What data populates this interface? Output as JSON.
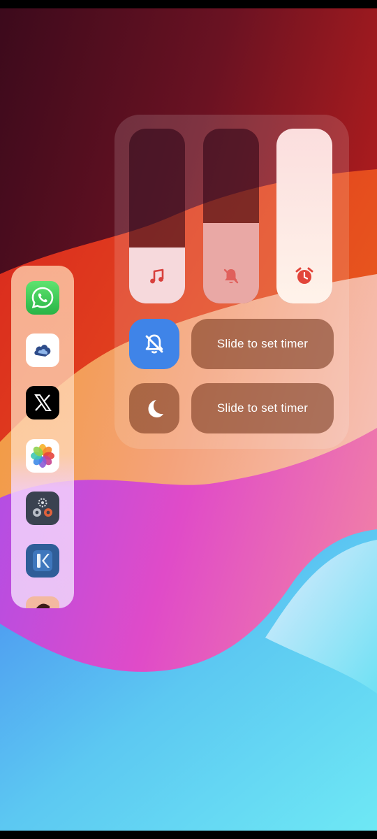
{
  "volume_panel": {
    "sliders": [
      {
        "id": "media",
        "icon": "music-note-icon",
        "level": 0.32
      },
      {
        "id": "ring",
        "icon": "bell-off-icon",
        "level": 0.46
      },
      {
        "id": "alarm",
        "icon": "alarm-clock-icon",
        "level": 1.0
      }
    ],
    "sound_mode_icon": "bell-off-icon",
    "dnd_icon": "moon-icon",
    "timer_1_label": "Slide to set timer",
    "timer_2_label": "Slide to set timer"
  },
  "side_bar": {
    "apps": [
      {
        "name": "WhatsApp",
        "icon": "whatsapp-icon"
      },
      {
        "name": "Cloud",
        "icon": "cloud-app-icon"
      },
      {
        "name": "X",
        "icon": "x-icon"
      },
      {
        "name": "Photos",
        "icon": "photos-icon"
      },
      {
        "name": "Settings",
        "icon": "gears-icon"
      },
      {
        "name": "KWGT",
        "icon": "kwgt-icon"
      },
      {
        "name": "Partial app",
        "icon": "partial-app-icon"
      }
    ]
  },
  "colors": {
    "accent_blue": "#3f84e8",
    "whatsapp_green": "#3fc35a",
    "alarm_red": "#e2453a"
  }
}
